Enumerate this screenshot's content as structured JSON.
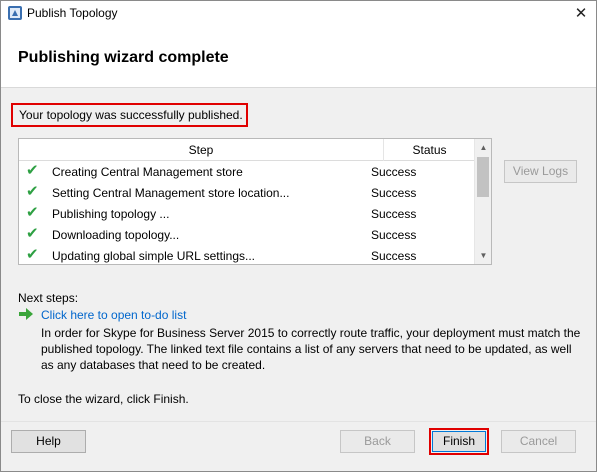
{
  "window": {
    "title": "Publish Topology",
    "app_icon": "topology-publish-icon",
    "close_glyph": "✕"
  },
  "header": {
    "title": "Publishing wizard complete"
  },
  "success_message": "Your topology was successfully published.",
  "table": {
    "columns": [
      "Step",
      "Status"
    ],
    "rows": [
      {
        "step": "Creating Central Management store",
        "status": "Success"
      },
      {
        "step": "Setting Central Management store location...",
        "status": "Success"
      },
      {
        "step": "Publishing topology ...",
        "status": "Success"
      },
      {
        "step": "Downloading topology...",
        "status": "Success"
      },
      {
        "step": "Updating global simple URL settings...",
        "status": "Success"
      }
    ],
    "row_icon": "green-check-icon"
  },
  "buttons": {
    "view_logs": "View Logs",
    "help": "Help",
    "back": "Back",
    "finish": "Finish",
    "cancel": "Cancel"
  },
  "next_steps": {
    "label": "Next steps:",
    "link_text": "Click here to open to-do list",
    "link_icon": "green-arrow-icon",
    "description": "In order for Skype for Business Server 2015 to correctly route traffic, your deployment must match the published topology. The linked text file contains a list of any servers that need to be updated, as well as any databases that need to be created."
  },
  "close_instruction": "To close the wizard, click Finish.",
  "colors": {
    "highlight_border": "#e00000",
    "check": "#2ea043",
    "link": "#0066cc"
  }
}
